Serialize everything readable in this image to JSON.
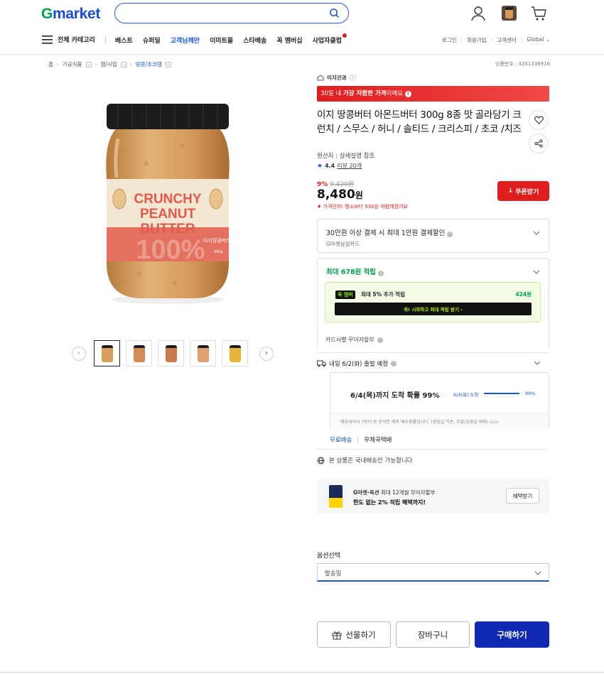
{
  "header": {
    "logo_g": "G",
    "logo_rest": "market",
    "search_placeholder": "",
    "all_category": "전체 카테고리",
    "nav": [
      {
        "label": "베스트"
      },
      {
        "label": "슈퍼딜"
      },
      {
        "label": "고객님께만",
        "highlight": true
      },
      {
        "label": "이마트몰"
      },
      {
        "label": "스타배송"
      },
      {
        "label": "꼭 멤버십"
      },
      {
        "label": "사업자클럽"
      }
    ],
    "util": [
      "로그인",
      "회원가입",
      "고객센터",
      "Global"
    ]
  },
  "breadcrumb": [
    "홈",
    "가공식품",
    "잼/시럽",
    "땅콩/초코잼"
  ],
  "product_no": "상품번호 : 4351338916",
  "seller": "이지건과",
  "banner": {
    "prefix": "30일 내 ",
    "strong": "가장 저렴한 가격",
    "suffix": "이에요"
  },
  "title": "이지 땅콩버터 아몬드버터 300g 8종 맛 골라담기 크런치 / 스무스 / 허니 / 솔티드 / 크리스피 / 초코 /치즈",
  "origin": "원산지 : 상세설명 참조",
  "rating": {
    "score": "4.4",
    "reviews": "리뷰 20개"
  },
  "price": {
    "discount": "9%",
    "original": "9,420원",
    "current": "8,480",
    "unit": "원",
    "note": "가격인하! 평소보다 530원 저렴해졌어요"
  },
  "coupon_btn": "쿠폰받기",
  "card_benefit": {
    "title": "30만원 이상 결제 시 최대 1만원 결제할인",
    "sub": "G마켓삼성카드"
  },
  "points": {
    "title": "최대 678원 적립",
    "member_badge": "꼭 멤버",
    "member_text": "최대 5% 추가 적립",
    "member_points": "424원",
    "member_btn": "꼭! 시작하고 최대 적립 받기 ›"
  },
  "installment": "카드사별 무이자할부",
  "shipping": {
    "title": "내일 6/2(화) 출발 예정",
    "arrival": "6/4(목)까지 도착 확률 99%",
    "bar_label": "6/4(목) 도착",
    "bar_pct": "99%",
    "bar_fill": 0.99,
    "note": "배송데이터 기반으로 분석한 예측 배송확률입니다. (영업일 기준, 주말/공휴일 제외)",
    "note_brand": "Solo",
    "tab_free": "무료배송",
    "tab_carrier": "우체국택배"
  },
  "domestic": "본 상품은 국내배송만 가능합니다",
  "promo": {
    "line1_brand": "G마켓·옥션",
    "line1_rest": " 최대 12개월 무이자할부",
    "line2": "한도 없는 2% 적립 혜택까지!",
    "btn": "혜택받기"
  },
  "option": {
    "label": "옵션선택",
    "selected": "발송일"
  },
  "buttons": {
    "gift": "선물하기",
    "cart": "장바구니",
    "buy": "구매하기"
  },
  "jar": {
    "line1": "CRUNCHY",
    "line2": "PEANUT",
    "line3": "BUTTER",
    "sub": "이지땅콩버터",
    "big": "100%",
    "net": "300g",
    "lid_color": "#1c1c1c",
    "label_color": "#f3e6d3",
    "accent_color": "#e15a4a"
  },
  "colors": {
    "brand_blue": "#1028b4",
    "red": "#e01e1e",
    "green": "#00a24b"
  }
}
